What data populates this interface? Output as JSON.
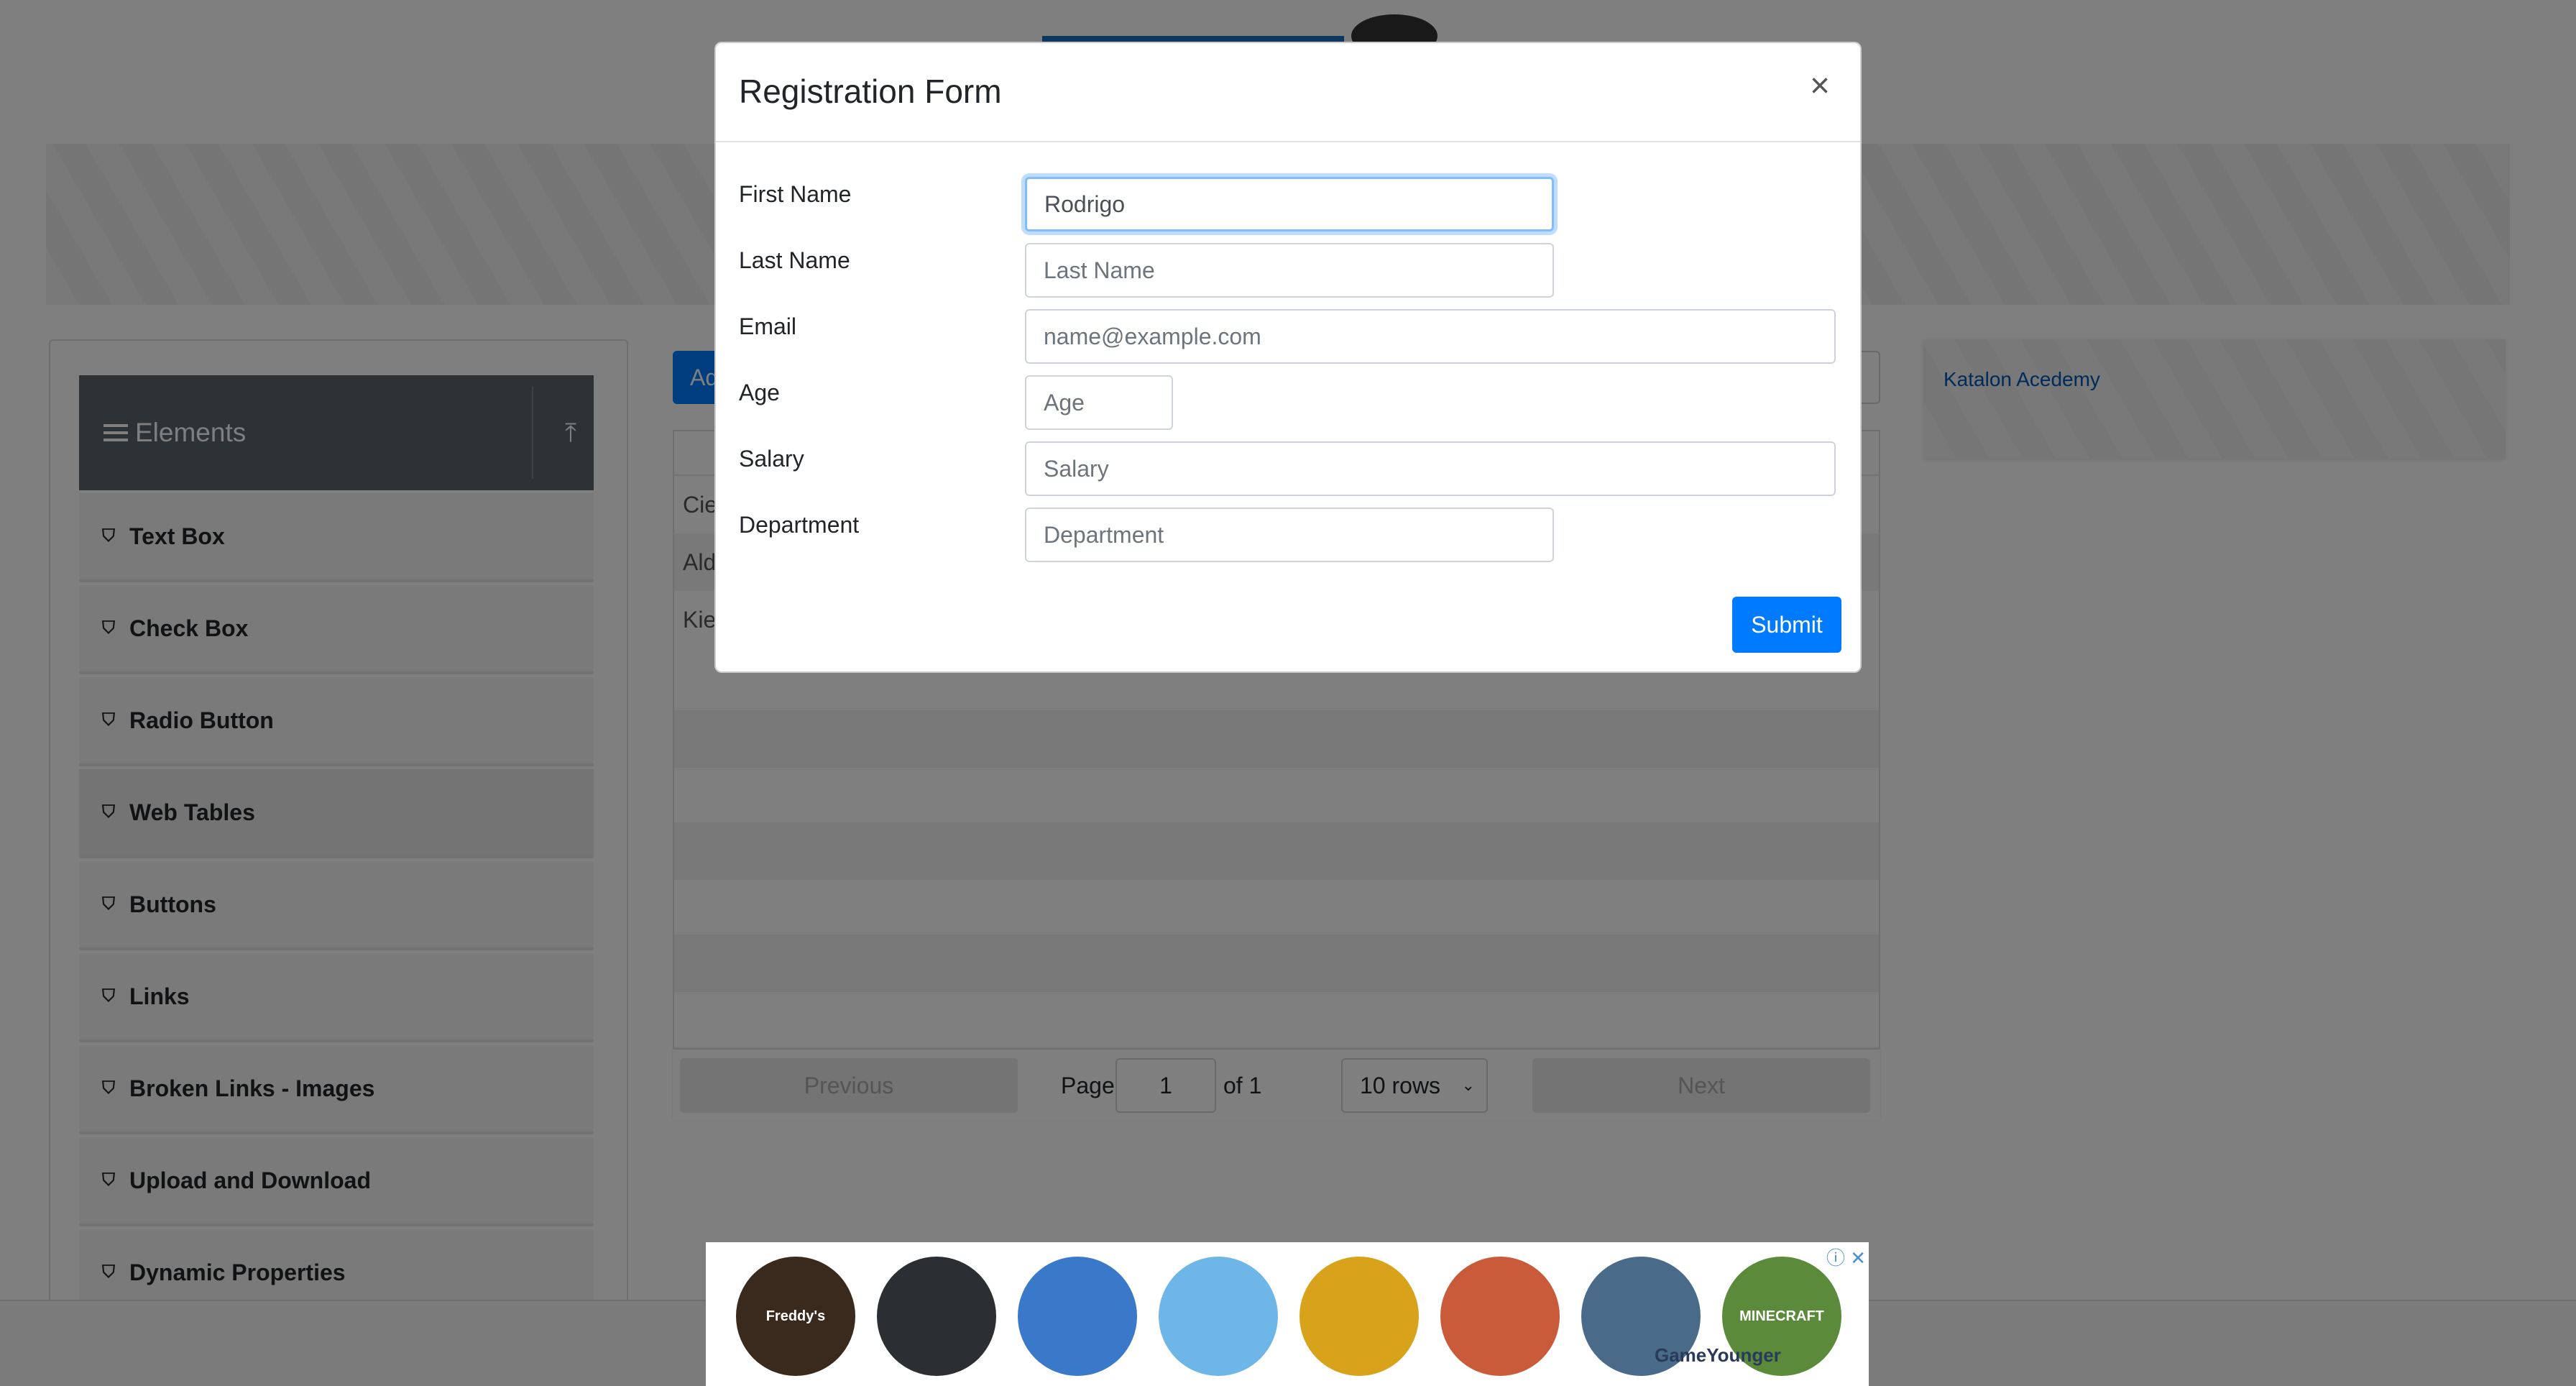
{
  "sidebar": {
    "header": "Elements",
    "items": [
      {
        "label": "Text Box"
      },
      {
        "label": "Check Box"
      },
      {
        "label": "Radio Button"
      },
      {
        "label": "Web Tables",
        "active": true
      },
      {
        "label": "Buttons"
      },
      {
        "label": "Links"
      },
      {
        "label": "Broken Links - Images"
      },
      {
        "label": "Upload and Download"
      },
      {
        "label": "Dynamic Properties"
      }
    ]
  },
  "toolbar": {
    "add_label": "Ad"
  },
  "table": {
    "rows": [
      "Cie",
      "Ald",
      "Kie"
    ]
  },
  "pagination": {
    "previous": "Previous",
    "page_label": "Page",
    "page_value": "1",
    "of_label": "of 1",
    "rows_select": "10 rows",
    "next": "Next"
  },
  "side_ad": {
    "alt": "Katalon Acedemy"
  },
  "modal": {
    "title": "Registration Form",
    "close_glyph": "×",
    "fields": {
      "first_name": {
        "label": "First Name",
        "value": "Rodrigo",
        "placeholder": "First Name"
      },
      "last_name": {
        "label": "Last Name",
        "value": "",
        "placeholder": "Last Name"
      },
      "email": {
        "label": "Email",
        "value": "",
        "placeholder": "name@example.com"
      },
      "age": {
        "label": "Age",
        "value": "",
        "placeholder": "Age"
      },
      "salary": {
        "label": "Salary",
        "value": "",
        "placeholder": "Salary"
      },
      "department": {
        "label": "Department",
        "value": "",
        "placeholder": "Department"
      }
    },
    "submit_label": "Submit"
  },
  "bottom_ad": {
    "badge": "ⓘ ✕",
    "watermark": "GameYounger",
    "games": [
      {
        "name": "five-nights-at-freddys",
        "label": "Freddy's",
        "color": "#3a2a1e"
      },
      {
        "name": "roblox",
        "label": "",
        "color": "#2b2e33"
      },
      {
        "name": "fortnite",
        "label": "",
        "color": "#3a78c9"
      },
      {
        "name": "hill-climb-racing",
        "label": "",
        "color": "#6fb6e8"
      },
      {
        "name": "temple-run",
        "label": "",
        "color": "#d9a21b"
      },
      {
        "name": "subway-surfers",
        "label": "",
        "color": "#c95a3a"
      },
      {
        "name": "pubg",
        "label": "",
        "color": "#4a6a8a"
      },
      {
        "name": "minecraft",
        "label": "MINECRAFT",
        "color": "#5a8a3a"
      }
    ]
  }
}
